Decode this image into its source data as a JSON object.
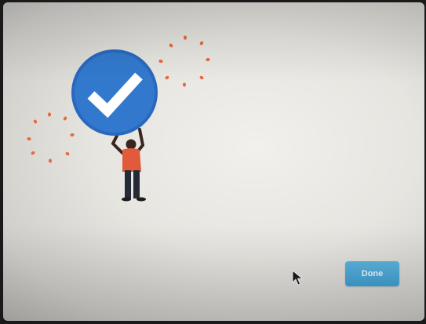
{
  "dialog": {
    "done_label": "Done"
  },
  "icons": {
    "illustration": "checkmark-badge-person-illustration",
    "cursor": "arrow-cursor-icon"
  },
  "colors": {
    "badge_blue": "#2f74c8",
    "figure_shirt": "#e05a3b",
    "sparkle": "#e8683f",
    "button_blue": "#4aa8d6"
  }
}
